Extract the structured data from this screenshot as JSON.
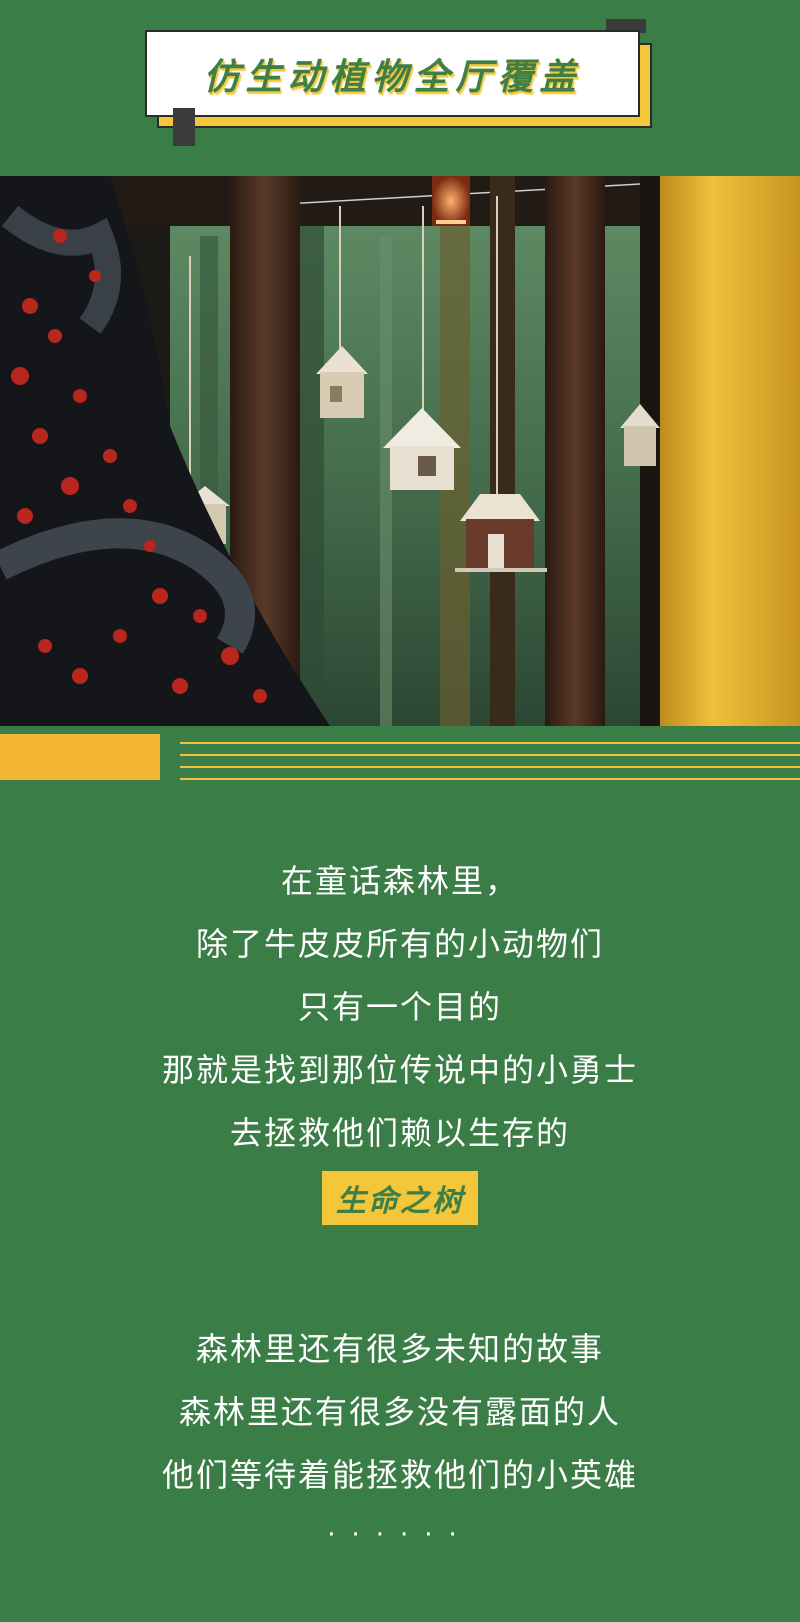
{
  "banner": {
    "title": "仿生动植物全厅覆盖"
  },
  "photo": {
    "description_icon": "forest-birdhouse-photo"
  },
  "story": {
    "lines": [
      "在童话森林里，",
      "除了牛皮皮所有的小动物们",
      "只有一个目的",
      "那就是找到那位传说中的小勇士",
      "去拯救他们赖以生存的"
    ],
    "highlight": "生命之树"
  },
  "story2": {
    "lines": [
      "森林里还有很多未知的故事",
      "森林里还有很多没有露面的人",
      "他们等待着能拯救他们的小英雄"
    ],
    "ellipsis": "······"
  },
  "colors": {
    "background": "#3a7d46",
    "accent_yellow": "#f4c63a",
    "title_green": "#3d7f47"
  }
}
